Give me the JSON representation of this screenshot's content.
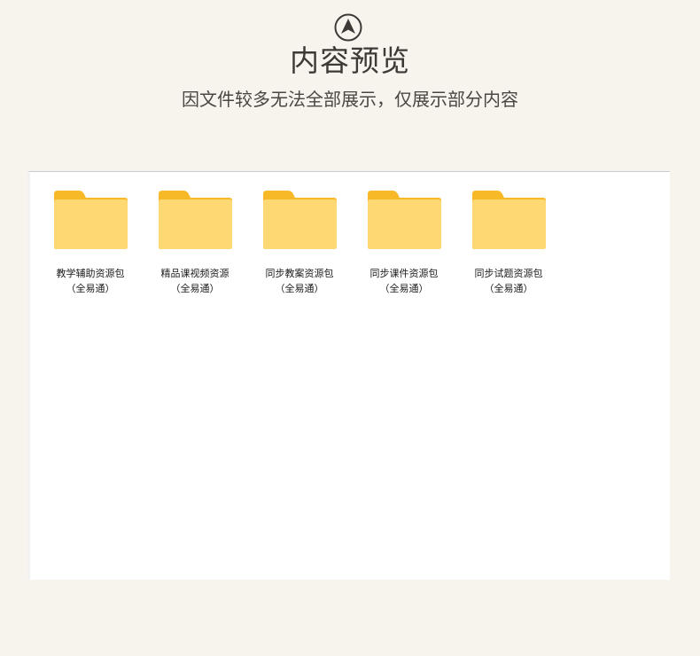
{
  "header": {
    "logo_icon": "compass-arrow-icon",
    "title": "内容预览",
    "subtitle": "因文件较多无法全部展示，仅展示部分内容"
  },
  "colors": {
    "background": "#f7f4ed",
    "panel": "#ffffff",
    "folder_back": "#f7b928",
    "folder_front": "#fdd873"
  },
  "folders": [
    {
      "icon": "folder-icon",
      "name": "教学辅助资源包",
      "sub": "（全易通）"
    },
    {
      "icon": "folder-icon",
      "name": "精品课视频资源",
      "sub": "（全易通）"
    },
    {
      "icon": "folder-icon",
      "name": "同步教案资源包",
      "sub": "（全易通）"
    },
    {
      "icon": "folder-icon",
      "name": "同步课件资源包",
      "sub": "（全易通）"
    },
    {
      "icon": "folder-icon",
      "name": "同步试题资源包",
      "sub": "（全易通）"
    }
  ]
}
